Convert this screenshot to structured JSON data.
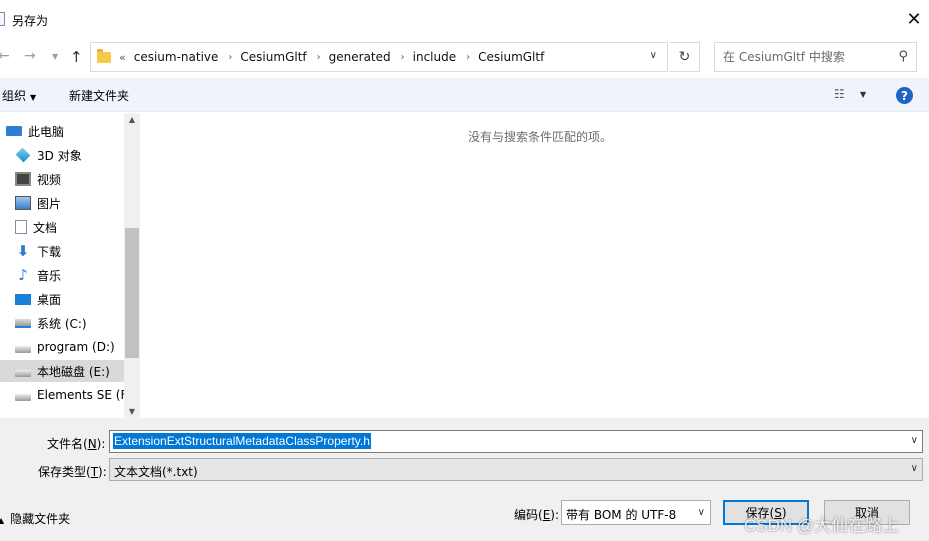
{
  "window": {
    "title": "另存为",
    "close_glyph": "✕"
  },
  "nav": {
    "back_glyph": "←",
    "forward_glyph": "→",
    "recent_glyph": "▼",
    "up_glyph": "↑"
  },
  "address": {
    "overflow": "«",
    "crumbs": [
      "cesium-native",
      "CesiumGltf",
      "generated",
      "include",
      "CesiumGltf"
    ],
    "separator": "›",
    "dropdown_glyph": "∨",
    "refresh_glyph": "↻"
  },
  "search": {
    "placeholder": "在 CesiumGltf 中搜索",
    "icon": "search-icon",
    "glyph": "⚲"
  },
  "toolbar": {
    "organize": "组织",
    "new_folder": "新建文件夹",
    "view_glyph": "☷",
    "caret": "▼",
    "help": "?"
  },
  "sidebar": {
    "items": [
      {
        "label": "此电脑",
        "icon": "computer-icon"
      },
      {
        "label": "3D 对象",
        "icon": "3d-objects-icon"
      },
      {
        "label": "视频",
        "icon": "video-icon"
      },
      {
        "label": "图片",
        "icon": "pictures-icon"
      },
      {
        "label": "文档",
        "icon": "documents-icon"
      },
      {
        "label": "下载",
        "icon": "downloads-icon"
      },
      {
        "label": "音乐",
        "icon": "music-icon"
      },
      {
        "label": "桌面",
        "icon": "desktop-icon"
      },
      {
        "label": "系统 (C:)",
        "icon": "system-drive-icon"
      },
      {
        "label": "program (D:)",
        "icon": "drive-icon"
      },
      {
        "label": "本地磁盘 (E:)",
        "icon": "drive-icon",
        "selected": true
      },
      {
        "label": "Elements SE (F:",
        "icon": "drive-icon"
      }
    ],
    "download_glyph": "⬇",
    "music_glyph": "♪"
  },
  "scrollbar": {
    "up_glyph": "▲",
    "down_glyph": "▼"
  },
  "content": {
    "empty_message": "没有与搜索条件匹配的项。"
  },
  "form": {
    "filename_label": "文件名(",
    "filename_key": "N",
    "filename_suffix": "):",
    "filename_value": "ExtensionExtStructuralMetadataClassProperty.h",
    "filetype_label": "保存类型(",
    "filetype_key": "T",
    "filetype_suffix": "):",
    "filetype_value": "文本文档(*.txt)",
    "dropdown_glyph": "∨"
  },
  "footer": {
    "hide_folders": "隐藏文件夹",
    "hide_caret": "▲",
    "encoding_label": "编码(",
    "encoding_key": "E",
    "encoding_suffix": "):",
    "encoding_value": "带有 BOM 的 UTF-8",
    "save_label": "保存(",
    "save_key": "S",
    "save_suffix": ")",
    "cancel_label": "取消"
  },
  "watermark": "CSDN @大仙在路上"
}
